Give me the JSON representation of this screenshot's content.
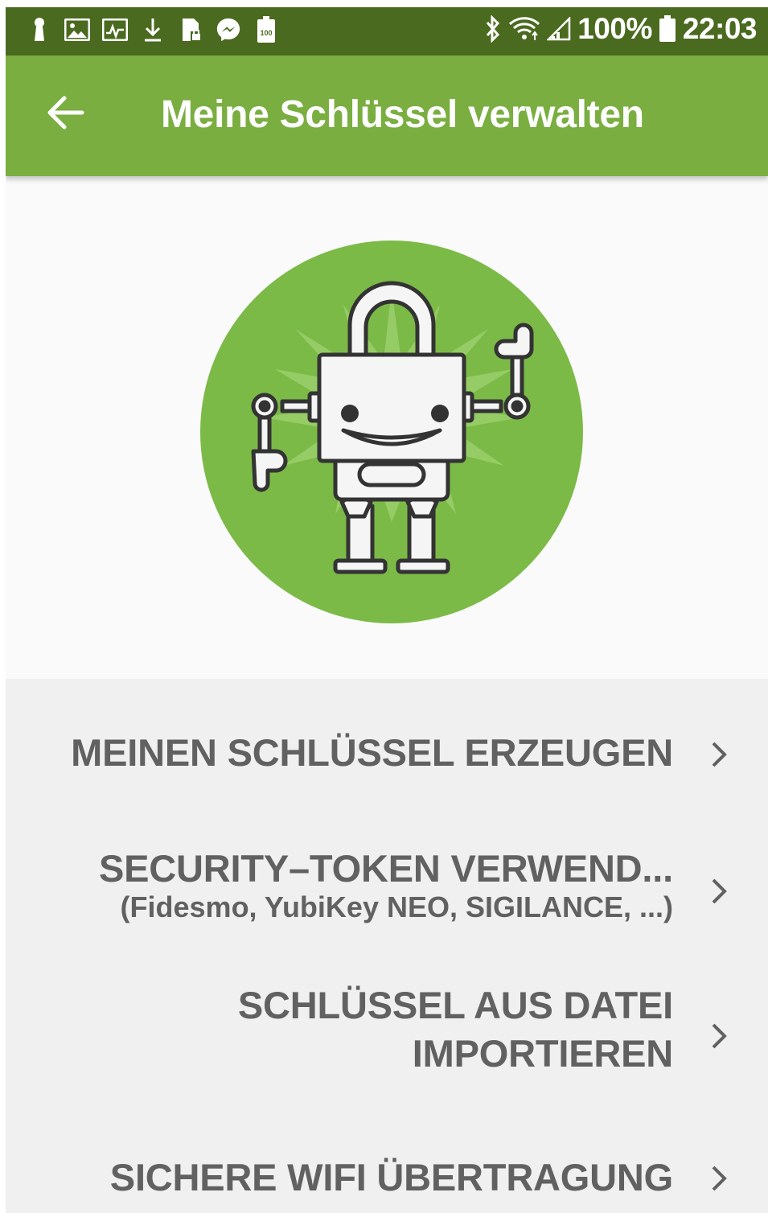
{
  "status_bar": {
    "battery_percent": "100%",
    "time": "22:03",
    "left_icons": [
      "keyhole-icon",
      "image-icon",
      "activity-icon",
      "download-icon",
      "sd-card-icon",
      "messenger-icon",
      "battery-100-icon"
    ],
    "right_icons": [
      "bluetooth-icon",
      "wifi-icon",
      "signal-icon",
      "battery-icon"
    ]
  },
  "app_bar": {
    "title": "Meine Schlüssel verwalten",
    "back_icon": "arrow-back-icon"
  },
  "hero": {
    "image": "robot-padlock-illustration"
  },
  "menu": {
    "items": [
      {
        "label": "MEINEN SCHLÜSSEL ERZEUGEN",
        "sub": ""
      },
      {
        "label": "SECURITY–TOKEN VERWEND...",
        "sub": "(Fidesmo, YubiKey NEO, SIGILANCE, ...)"
      },
      {
        "label_line1": "SCHLÜSSEL AUS DATEI",
        "label_line2": "IMPORTIEREN"
      },
      {
        "label": "SICHERE WIFI ÜBERTRAGUNG",
        "sub": ""
      }
    ]
  },
  "colors": {
    "status_bar": "#4a6a1f",
    "app_bar": "#7aae40",
    "hero_circle": "#7cba48",
    "menu_bg": "#f0f0f0",
    "menu_text": "#616161"
  }
}
